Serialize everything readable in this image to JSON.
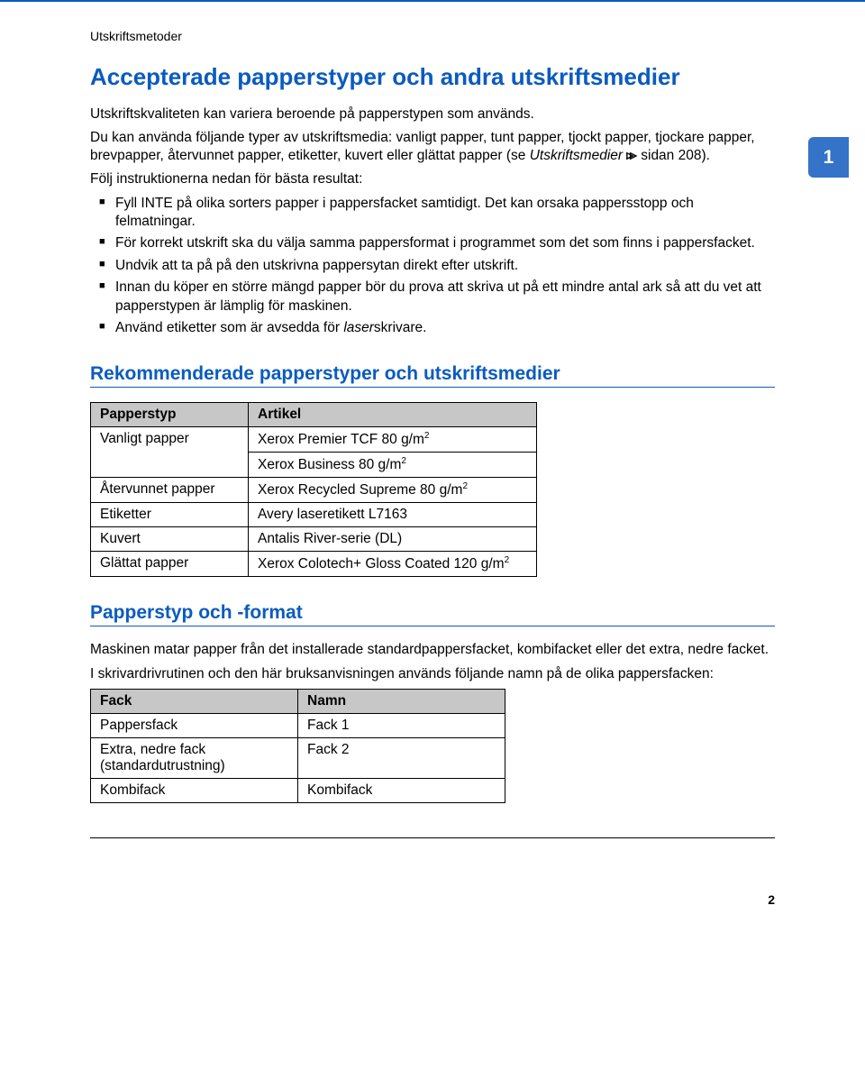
{
  "sideTab": "1",
  "breadcrumb": "Utskriftsmetoder",
  "h1": "Accepterade papperstyper och andra utskriftsmedier",
  "intro1": "Utskriftskvaliteten kan variera beroende på papperstypen som används.",
  "intro2a": "Du kan använda följande typer av utskriftsmedia: vanligt papper, tunt papper, tjockt papper, tjockare papper, brevpapper, återvunnet papper, etiketter, kuvert eller glättat papper (se ",
  "intro2b": "Utskriftsmedier",
  "intro2c": " sidan 208).",
  "followHeading": "Följ instruktionerna nedan för bästa resultat:",
  "bullets": [
    "Fyll INTE på olika sorters papper i pappersfacket samtidigt. Det kan orsaka pappersstopp och felmatningar.",
    "För korrekt utskrift ska du välja samma pappersformat i programmet som det som finns i pappersfacket.",
    "Undvik att ta på på den utskrivna pappersytan direkt efter utskrift.",
    "Innan du köper en större mängd papper bör du prova att skriva ut på ett mindre antal ark så att du vet att papperstypen är lämplig för maskinen.",
    "Använd etiketter som är avsedda för laserskrivare."
  ],
  "h2a": "Rekommenderade papperstyper och utskriftsmedier",
  "table1": {
    "headers": [
      "Papperstyp",
      "Artikel"
    ],
    "rows": [
      [
        "Vanligt papper",
        "Xerox Premier TCF 80 g/m",
        "2"
      ],
      [
        "",
        "Xerox Business 80 g/m",
        "2"
      ],
      [
        "Återvunnet papper",
        "Xerox Recycled Supreme 80 g/m",
        "2"
      ],
      [
        "Etiketter",
        "Avery laseretikett L7163",
        ""
      ],
      [
        "Kuvert",
        "Antalis River-serie (DL)",
        ""
      ],
      [
        "Glättat papper",
        "Xerox Colotech+ Gloss Coated 120 g/m",
        "2"
      ]
    ]
  },
  "h2b": "Papperstyp och -format",
  "p3": "Maskinen matar papper från det installerade standardpappersfacket, kombifacket eller det extra, nedre facket.",
  "p4": "I skrivardrivrutinen och den här bruksanvisningen används följande namn på de olika pappersfacken:",
  "table2": {
    "headers": [
      "Fack",
      "Namn"
    ],
    "rows": [
      [
        "Pappersfack",
        "Fack 1"
      ],
      [
        "Extra, nedre fack (standardutrustning)",
        "Fack 2"
      ],
      [
        "Kombifack",
        "Kombifack"
      ]
    ]
  },
  "pageNumber": "2"
}
